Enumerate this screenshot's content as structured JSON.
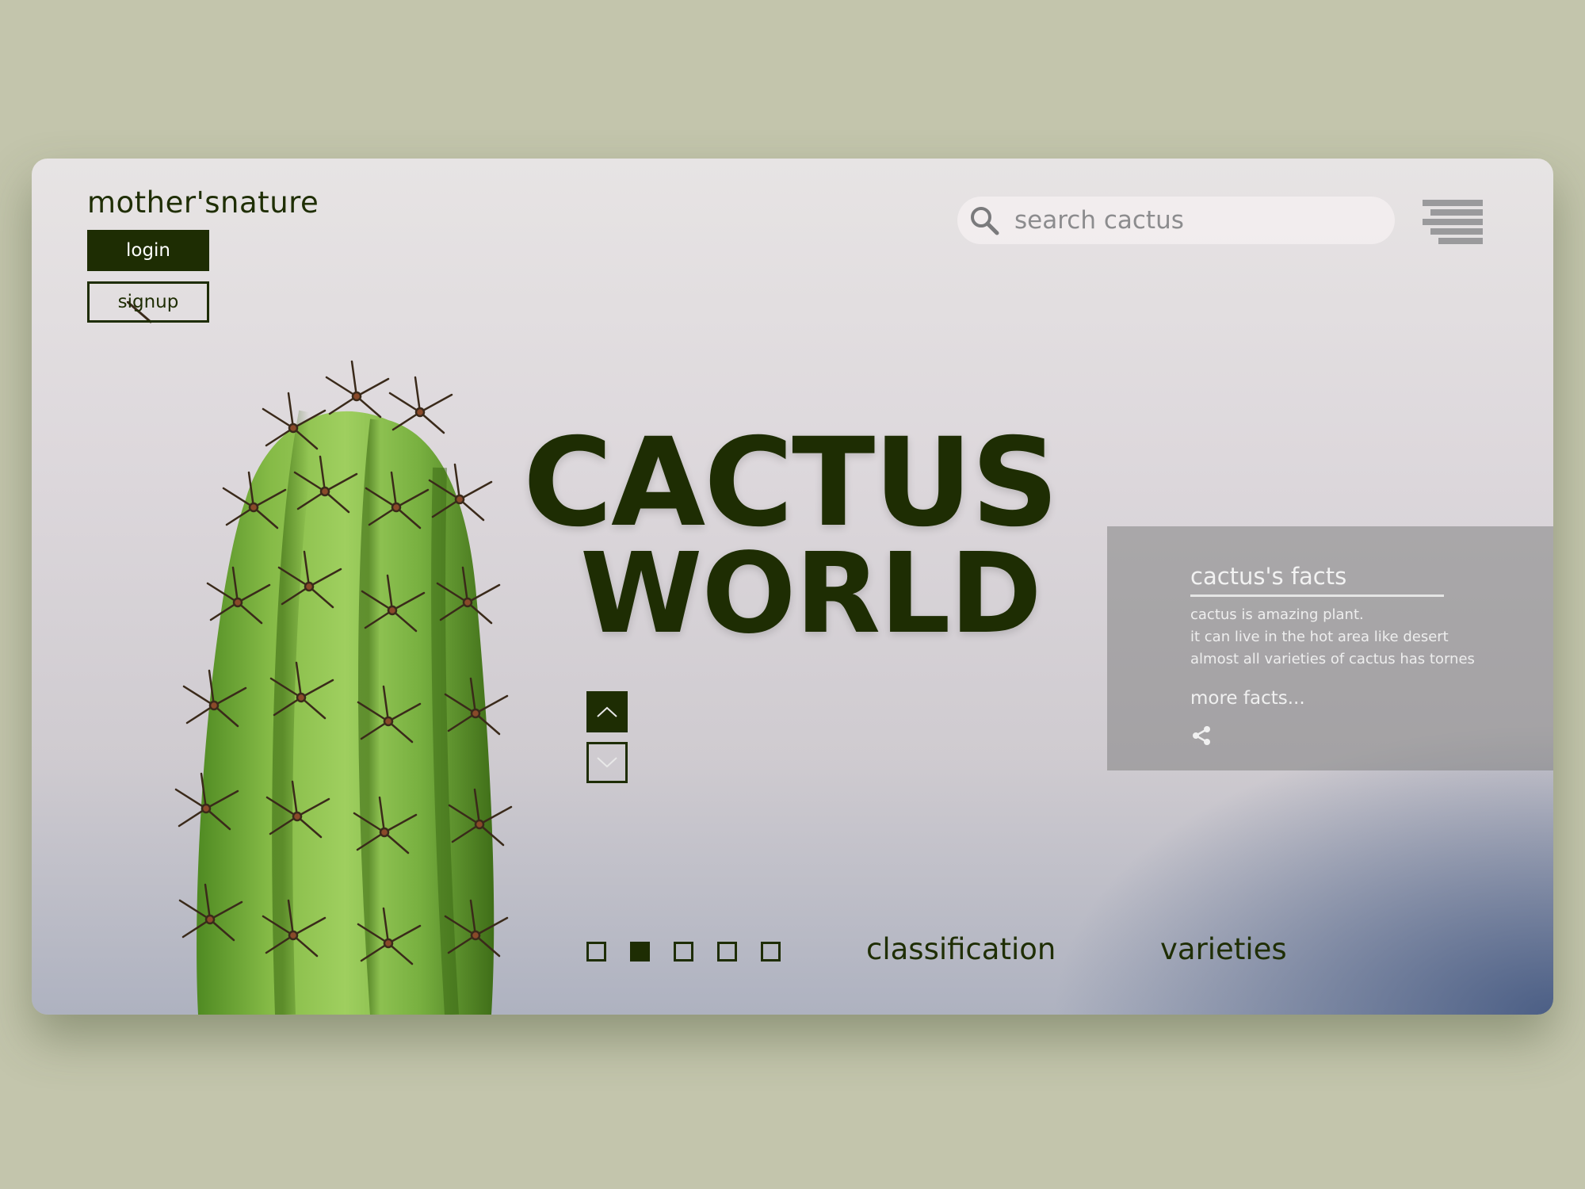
{
  "brand": {
    "name": "mother'snature"
  },
  "auth": {
    "login_label": "login",
    "signup_label": "signup"
  },
  "search": {
    "placeholder": "search cactus"
  },
  "hero": {
    "line1": "CACTUS",
    "line2": "WORLD"
  },
  "facts": {
    "title": "cactus's facts",
    "lines": [
      "cactus is amazing plant.",
      "it can live in the hot area like desert",
      "almost all varieties of cactus has tornes"
    ],
    "more_label": "more facts..."
  },
  "pager": {
    "count": 5,
    "active_index": 2
  },
  "nav": {
    "classification": "classification",
    "varieties": "varieties"
  },
  "icons": [
    "search-icon",
    "menu-icon",
    "chevron-up-icon",
    "chevron-down-icon",
    "share-icon"
  ],
  "colors": {
    "accent": "#1e2d03",
    "background": "#c3c5ac"
  }
}
